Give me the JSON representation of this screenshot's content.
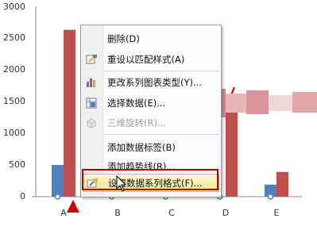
{
  "chart_data": {
    "type": "bar",
    "categories": [
      "A",
      "B",
      "C",
      "D",
      "E"
    ],
    "series": [
      {
        "values": [
          500,
          0,
          0,
          0,
          190
        ],
        "color": "#4f81bd"
      },
      {
        "values": [
          2630,
          0,
          0,
          1600,
          390
        ],
        "color": "#c0504d"
      }
    ],
    "ylim": [
      0,
      3000
    ],
    "yticks": [
      0,
      500,
      1000,
      1500,
      2000,
      2500,
      3000
    ],
    "grid": false
  },
  "context_menu": {
    "items": [
      {
        "label": "删除(D)",
        "icon": "none",
        "disabled": false
      },
      {
        "label": "重设以匹配样式(A)",
        "icon": "reset-style-icon",
        "disabled": false
      },
      {
        "label": "更改系列图表类型(Y)...",
        "icon": "chart-type-icon",
        "disabled": false
      },
      {
        "label": "选择数据(E)...",
        "icon": "select-data-icon",
        "disabled": false
      },
      {
        "label": "三维旋转(R)...",
        "icon": "3d-rotate-icon",
        "disabled": true
      },
      {
        "label": "添加数据标签(B)",
        "icon": "none",
        "disabled": false
      },
      {
        "label": "添加趋势线(R)...",
        "icon": "none",
        "disabled": false
      },
      {
        "label": "设置数据系列格式(F)...",
        "icon": "format-series-icon",
        "disabled": false,
        "highlighted": true
      }
    ]
  },
  "colors": {
    "accent_highlight": "#fde58a",
    "annotation_red": "#c00000"
  }
}
